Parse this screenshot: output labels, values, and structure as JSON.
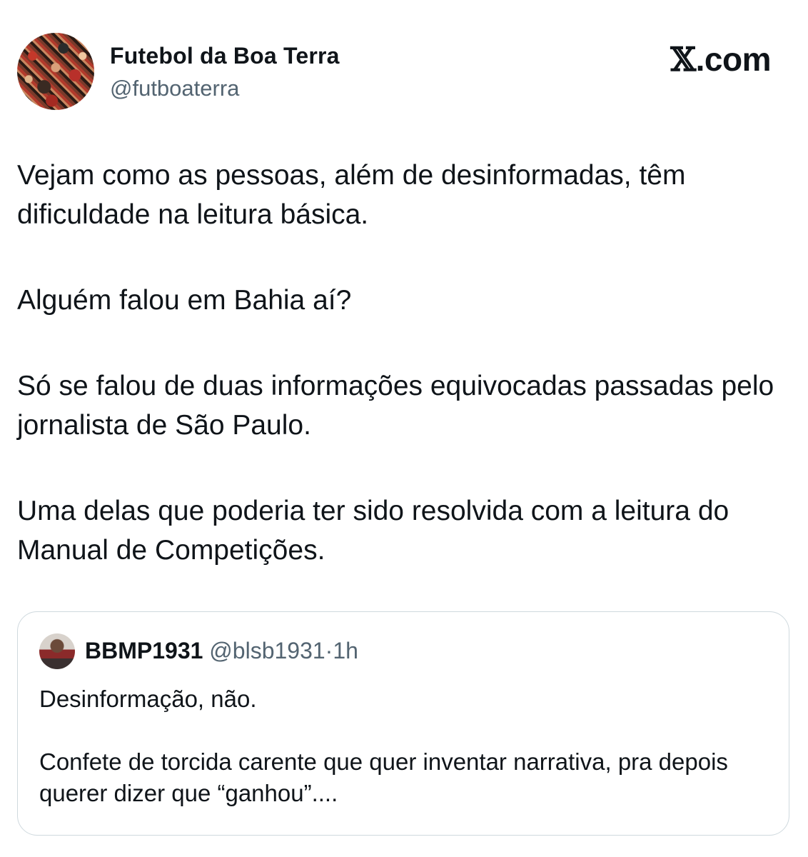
{
  "author": {
    "name": "Futebol da Boa Terra",
    "handle": "@futboaterra"
  },
  "brand": {
    "x_glyph": "𝕏",
    "suffix": ".com"
  },
  "tweet": {
    "paragraphs": [
      "Vejam como as pessoas, além de desinformadas, têm dificuldade na leitura básica.",
      "Alguém falou em Bahia aí?",
      "Só se falou de duas informações equivocadas passadas pelo jornalista de São Paulo.",
      "Uma delas que poderia ter sido resolvida com a leitura do Manual de Competições."
    ]
  },
  "quote": {
    "name": "BBMP1931",
    "handle": "@blsb1931",
    "separator": "·",
    "time": "1h",
    "paragraphs": [
      "Desinformação, não.",
      "Confete de torcida carente que quer inventar narrativa, pra depois querer dizer que “ganhou”...."
    ]
  },
  "colors": {
    "text": "#0f1419",
    "secondary": "#536471",
    "border": "#cfd9de"
  }
}
